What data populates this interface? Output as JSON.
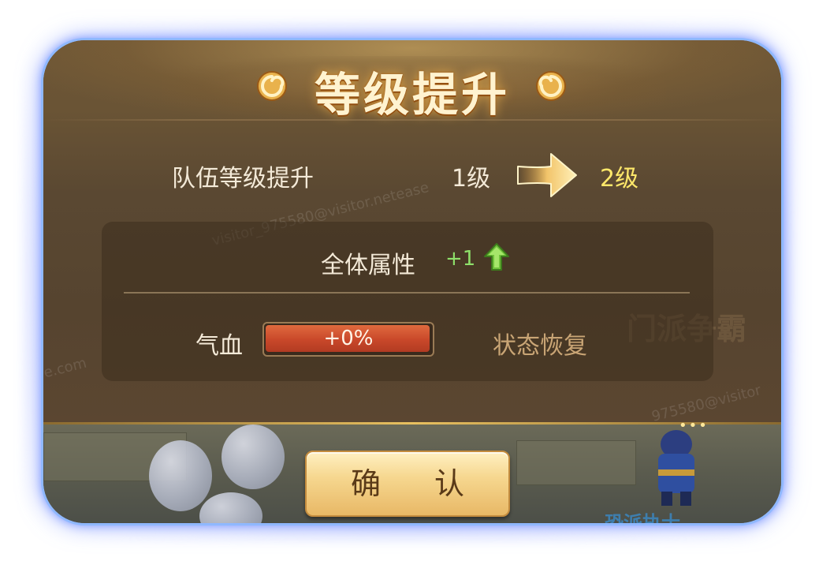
{
  "dialog": {
    "title": "等级提升",
    "team_level_label": "队伍等级提升",
    "level_from": "1级",
    "level_to": "2级"
  },
  "attributes": {
    "all_label": "全体属性",
    "all_value": "+1",
    "hp_label": "气血",
    "hp_bar_text": "+0%",
    "hp_bar_fraction": 0.99,
    "status_label": "状态恢复"
  },
  "buttons": {
    "confirm_label": "确 认"
  },
  "scene": {
    "background_text": "门派争霸",
    "bottom_text": "恐派执士"
  },
  "watermark": {
    "text_1": "visitor_975580@visitor.netease",
    "text_2": "975580@visitor",
    "text_3": "e.com"
  },
  "colors": {
    "frame_glow": "#8fb8ff",
    "level_to": "#ffe86a",
    "attr_value": "#8ee06a",
    "hp_fill": "#c9482a",
    "status": "#c9a575",
    "button": "#f6d78f"
  }
}
